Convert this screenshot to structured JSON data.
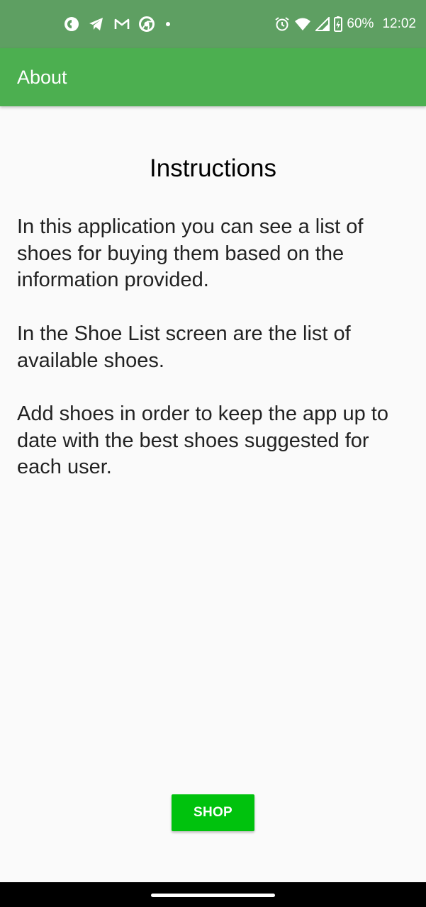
{
  "status_bar": {
    "battery_text": "60%",
    "time": "12:02",
    "notification_icons": [
      "app-c-icon",
      "telegram-icon",
      "gmail-icon",
      "chrome-icon",
      "more-dot-icon"
    ],
    "system_icons": [
      "alarm-icon",
      "wifi-icon",
      "signal-icon",
      "battery-icon"
    ],
    "background_color": "#5e9f62"
  },
  "app_bar": {
    "title": "About",
    "background_color": "#4caf50"
  },
  "content": {
    "heading": "Instructions",
    "body": " In this application you can see a list of shoes for buying them based on the information provided.\n\n In the Shoe List screen are the list of available shoes.\n\n Add shoes in order to keep the app up to date with the best shoes suggested for each user."
  },
  "actions": {
    "shop_label": "SHOP",
    "shop_color": "#00c20d"
  }
}
